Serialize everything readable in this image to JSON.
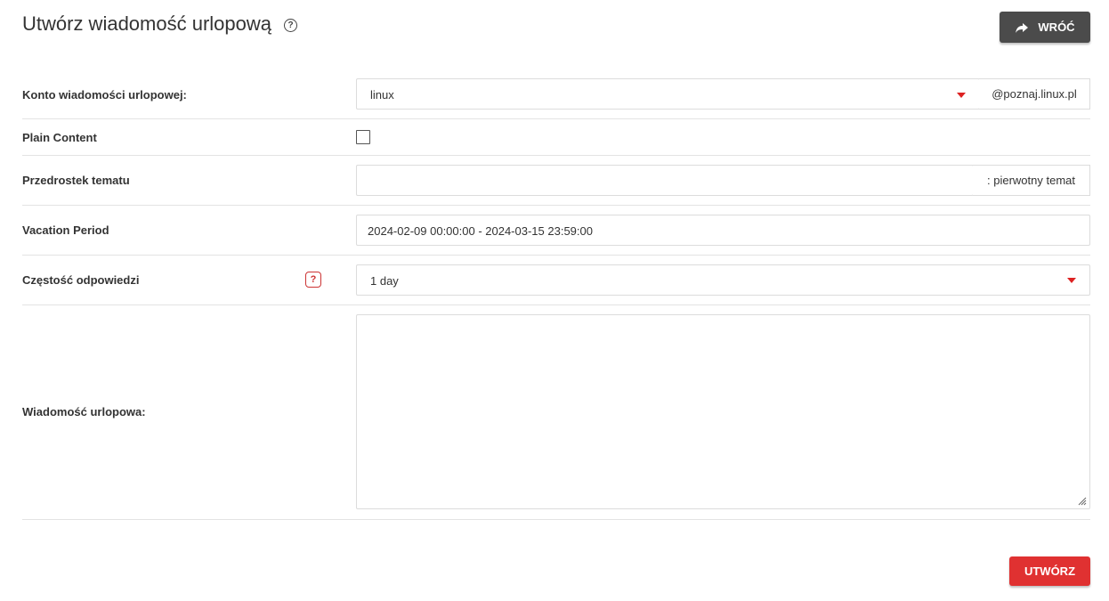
{
  "header": {
    "title": "Utwórz wiadomość urlopową",
    "help_icon": "question-circle-icon",
    "back_label": "WRÓĆ",
    "back_icon": "share-arrow-icon"
  },
  "form": {
    "account": {
      "label": "Konto wiadomości urlopowej:",
      "value": "linux",
      "domain": "@poznaj.linux.pl"
    },
    "plain_content": {
      "label": "Plain Content",
      "checked": false
    },
    "subject_prefix": {
      "label": "Przedrostek tematu",
      "value": "",
      "suffix": ": pierwotny temat"
    },
    "vacation_period": {
      "label": "Vacation Period",
      "value": "2024-02-09 00:00:00 - 2024-03-15 23:59:00"
    },
    "reply_frequency": {
      "label": "Częstość odpowiedzi",
      "help_text": "?",
      "value": "1 day"
    },
    "message": {
      "label": "Wiadomość urlopowa:",
      "value": ""
    }
  },
  "footer": {
    "create_label": "UTWÓRZ"
  },
  "colors": {
    "accent_red": "#e03131",
    "back_button": "#4b4b4b"
  }
}
